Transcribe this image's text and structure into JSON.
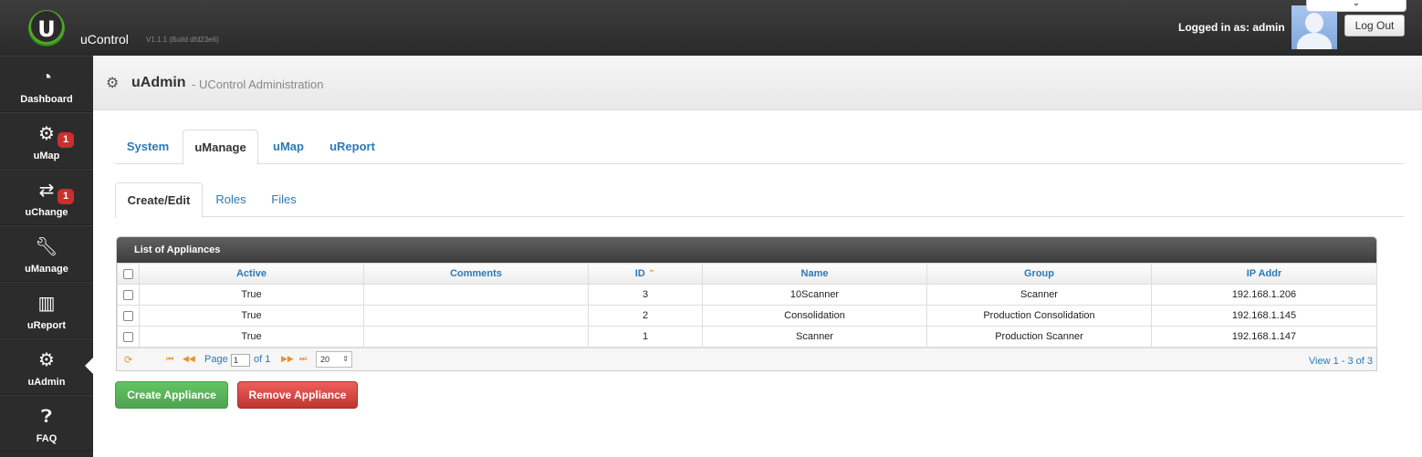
{
  "header": {
    "logo_letter": "U",
    "app_name": "uControl",
    "app_version": "V1.1.1 (Build dfd23e6)",
    "logged_in": "Logged in as: admin",
    "logout_label": "Log Out",
    "dropdown_icon": "chevron-down-icon"
  },
  "sidebar": {
    "items": [
      {
        "label": "Dashboard",
        "icon": "dashboard-icon",
        "badge": ""
      },
      {
        "label": "uMap",
        "icon": "gear-icon",
        "badge": "1"
      },
      {
        "label": "uChange",
        "icon": "retweet-icon",
        "badge": "1"
      },
      {
        "label": "uManage",
        "icon": "wrench-icon",
        "badge": ""
      },
      {
        "label": "uReport",
        "icon": "bar-chart-icon",
        "badge": ""
      },
      {
        "label": "uAdmin",
        "icon": "gears-icon",
        "badge": ""
      },
      {
        "label": "FAQ",
        "icon": "question-icon",
        "badge": ""
      }
    ]
  },
  "page": {
    "title": "uAdmin",
    "subtitle": "- UControl Administration"
  },
  "tabs": [
    "System",
    "uManage",
    "uMap",
    "uReport"
  ],
  "subtabs": [
    "Create/Edit",
    "Roles",
    "Files"
  ],
  "grid": {
    "caption": "List of Appliances",
    "columns": [
      "Active",
      "Comments",
      "ID",
      "Name",
      "Group",
      "IP Addr"
    ],
    "rows": [
      {
        "active": "True",
        "comments": "",
        "id": "3",
        "name": "10Scanner",
        "group": "Scanner",
        "ip": "192.168.1.206"
      },
      {
        "active": "True",
        "comments": "",
        "id": "2",
        "name": "Consolidation",
        "group": "Production Consolidation",
        "ip": "192.168.1.145"
      },
      {
        "active": "True",
        "comments": "",
        "id": "1",
        "name": "Scanner",
        "group": "Production Scanner",
        "ip": "192.168.1.147"
      }
    ],
    "pager": {
      "page_label": "Page",
      "page_value": "1",
      "of_label": "of 1",
      "page_size": "20",
      "view_info": "View 1 - 3 of 3"
    }
  },
  "buttons": {
    "create": "Create Appliance",
    "remove": "Remove Appliance"
  },
  "colors": {
    "accent": "#2a7ab8",
    "success": "#51a351",
    "danger": "#bd362f",
    "badge": "#c9302c"
  }
}
